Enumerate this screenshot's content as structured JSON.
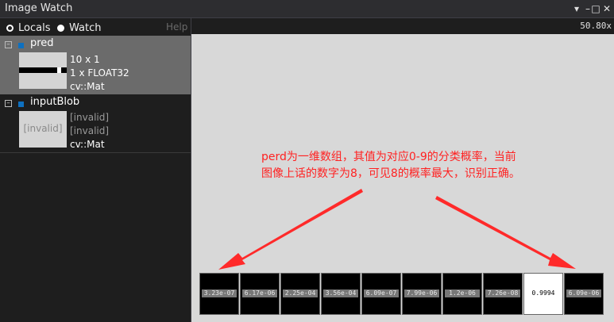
{
  "window": {
    "title": "Image Watch"
  },
  "left_panel": {
    "locals_label": "Locals",
    "watch_label": "Watch",
    "help_label": "Help",
    "entries": [
      {
        "name": "pred",
        "thumb_text": "",
        "lines": [
          "10 x 1",
          "1 x FLOAT32",
          "cv::Mat"
        ]
      },
      {
        "name": "inputBlob",
        "thumb_text": "[invalid]",
        "lines": [
          "[invalid]",
          "[invalid]",
          "cv::Mat"
        ]
      }
    ]
  },
  "viewer": {
    "zoom": "50.80x",
    "annotation_line1": "perd为一维数组，其值为对应0-9的分类概率，当前",
    "annotation_line2": "图像上话的数字为8，可见8的概率最大，识别正确。",
    "annotation_color": "#ff2222",
    "cells": [
      "3.23e-07",
      "6.17e-06",
      "2.25e-04",
      "3.56e-04",
      "6.09e-07",
      "7.99e-06",
      "1.2e-06",
      "7.26e-08",
      "0.9994",
      "6.09e-06"
    ],
    "highlighted_cell": 8
  },
  "title_controls": [
    "dropdown-icon",
    "minimize-icon",
    "maximize-icon",
    "close-icon"
  ]
}
